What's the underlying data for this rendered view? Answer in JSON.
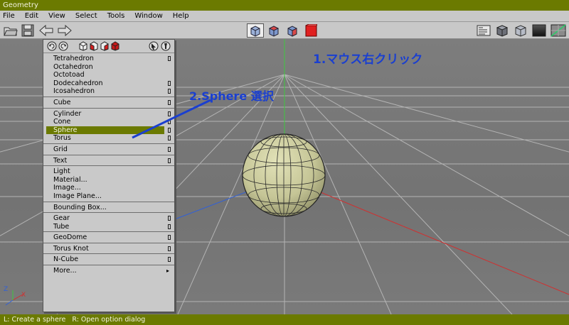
{
  "window": {
    "title": "Geometry"
  },
  "menubar": [
    "File",
    "Edit",
    "View",
    "Select",
    "Tools",
    "Window",
    "Help"
  ],
  "toolbar": {
    "left_icons": [
      "open-folder-icon",
      "save-disk-icon",
      "back-arrow-icon",
      "forward-arrow-icon"
    ],
    "center_icons": [
      "cube-blue-icon",
      "cube-blue-red-icon",
      "cube-blue-red-2-icon",
      "cube-red-icon"
    ],
    "right_icons": [
      "panel-list-icon",
      "shaded-cube-icon",
      "wire-cube-icon",
      "gradient-bg-icon",
      "textured-bg-icon"
    ]
  },
  "context_menu": {
    "header_icons": [
      "rotate-left-icon",
      "rotate-right-icon",
      "cube-outline-icon",
      "cube-red-face-icon",
      "cube-red-side-icon",
      "cube-red-full-icon",
      "pointer-icon",
      "gear-icon"
    ],
    "groups": [
      {
        "items": [
          {
            "label": "Tetrahedron",
            "option": true
          },
          {
            "label": "Octahedron",
            "option": false
          },
          {
            "label": "Octotoad",
            "option": false
          },
          {
            "label": "Dodecahedron",
            "option": true
          },
          {
            "label": "Icosahedron",
            "option": true
          }
        ]
      },
      {
        "items": [
          {
            "label": "Cube",
            "option": true
          }
        ]
      },
      {
        "items": [
          {
            "label": "Cylinder",
            "option": true
          },
          {
            "label": "Cone",
            "option": true
          },
          {
            "label": "Sphere",
            "option": true,
            "selected": true
          },
          {
            "label": "Torus",
            "option": true
          }
        ]
      },
      {
        "items": [
          {
            "label": "Grid",
            "option": true
          }
        ]
      },
      {
        "items": [
          {
            "label": "Text",
            "option": true
          }
        ]
      },
      {
        "items": [
          {
            "label": "Light",
            "option": false
          },
          {
            "label": "Material...",
            "option": false
          },
          {
            "label": "Image...",
            "option": false
          },
          {
            "label": "Image Plane...",
            "option": false
          }
        ]
      },
      {
        "items": [
          {
            "label": "Bounding Box...",
            "option": false
          }
        ]
      },
      {
        "items": [
          {
            "label": "Gear",
            "option": true
          },
          {
            "label": "Tube",
            "option": true
          }
        ]
      },
      {
        "items": [
          {
            "label": "GeoDome",
            "option": true
          }
        ]
      },
      {
        "items": [
          {
            "label": "Torus Knot",
            "option": true
          }
        ]
      },
      {
        "items": [
          {
            "label": "N-Cube",
            "option": true
          }
        ]
      },
      {
        "items": [
          {
            "label": "More...",
            "option": false,
            "submenu": true
          }
        ]
      }
    ]
  },
  "annotations": {
    "step1": "1.マウス右クリック",
    "step2": "2.Sphere 選択"
  },
  "viewport": {
    "axis_labels": {
      "z": "Z",
      "x": "X"
    },
    "colors": {
      "x_axis": "#d03030",
      "y_axis": "#3ec83e",
      "z_axis": "#3060d8",
      "sphere": "#c9c99a",
      "grid": "#b8b8b8",
      "annotation": "#1a3fd0"
    }
  },
  "statusbar": {
    "text": "L: Create a sphere   R: Open option dialog"
  }
}
